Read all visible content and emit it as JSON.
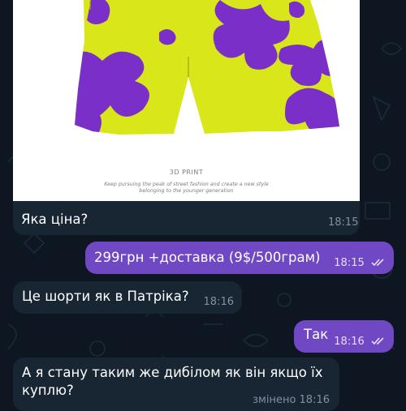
{
  "colors": {
    "background": "#0e1621",
    "incoming_bubble": "#182533",
    "outgoing_bubble": "#7048c4",
    "shorts_yellow": "#d8e61a",
    "shorts_purple": "#7a2fc8"
  },
  "image_message": {
    "print_title": "3D PRINT",
    "print_subtitle_line1": "Keep pursuing the peak of street fashion and create a new style",
    "print_subtitle_line2": "belonging to the younger generation",
    "caption": "Яка ціна?",
    "time": "18:15"
  },
  "messages": [
    {
      "direction": "out",
      "text": "299грн +доставка (9$/500грам)",
      "time": "18:15",
      "status": "read"
    },
    {
      "direction": "in",
      "text": "Це шорти як в Патріка?",
      "time": "18:16"
    },
    {
      "direction": "out",
      "text": "Так",
      "time": "18:16",
      "status": "read"
    },
    {
      "direction": "in",
      "text_line1": "А я стану таким же дибілом як він якщо їх",
      "text_line2": "куплю?",
      "time": "змінено 18:16"
    }
  ],
  "icons": [
    "double-check-icon"
  ]
}
